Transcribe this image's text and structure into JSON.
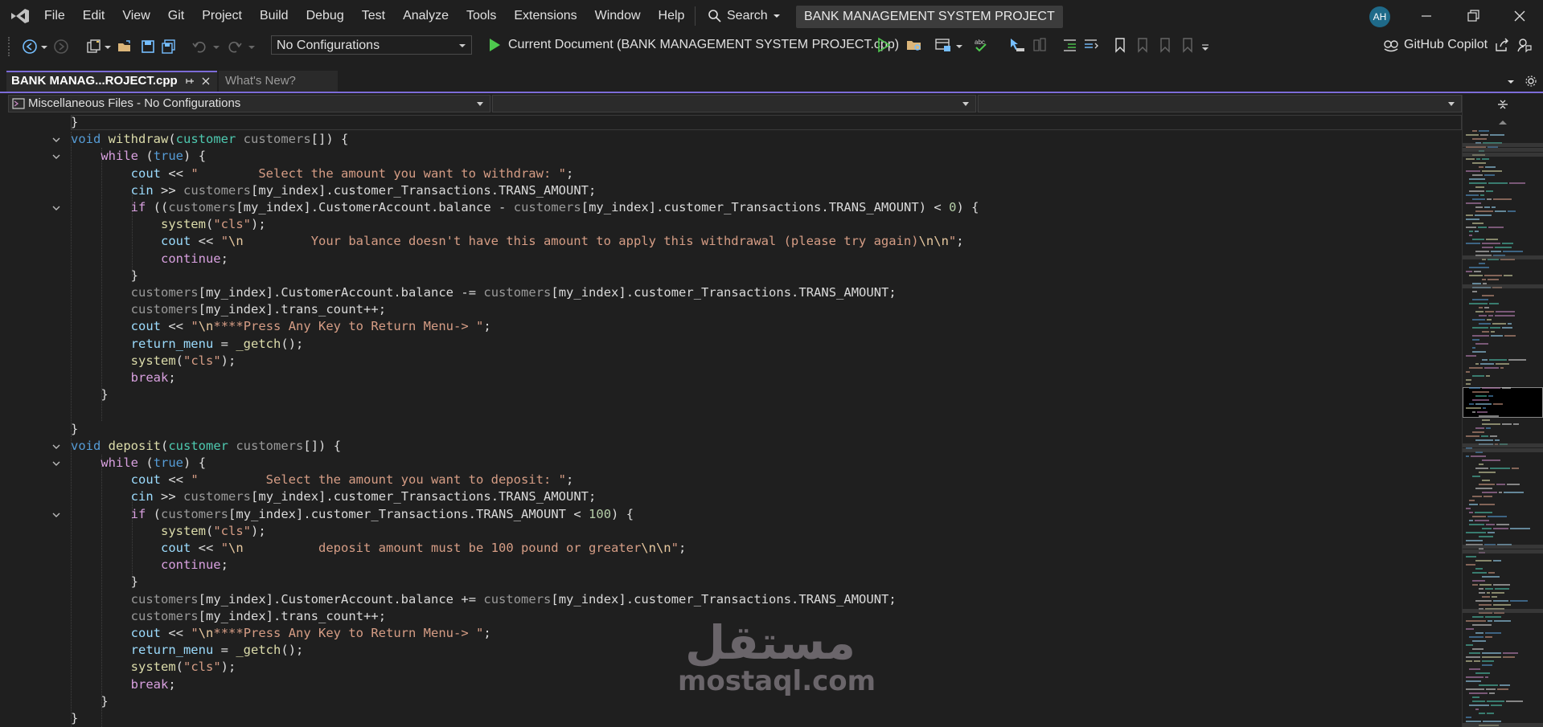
{
  "menu": [
    "File",
    "Edit",
    "View",
    "Git",
    "Project",
    "Build",
    "Debug",
    "Test",
    "Analyze",
    "Tools",
    "Extensions",
    "Window",
    "Help"
  ],
  "search_label": "Search",
  "window_title": "BANK MANAGEMENT SYSTEM PROJECT",
  "avatar_initials": "AH",
  "toolbar": {
    "configuration": "No Configurations",
    "run_target": "Current Document (BANK MANAGEMENT SYSTEM PROJECT.cpp)",
    "copilot": "GitHub Copilot"
  },
  "tabs": {
    "active": "BANK MANAG...ROJECT.cpp",
    "inactive": "What's New?"
  },
  "navbar": {
    "scope": "Miscellaneous Files - No Configurations"
  },
  "code_lines": [
    "}",
    "void withdraw(customer customers[]) {",
    "    while (true) {",
    "        cout << \"        Select the amount you want to withdraw: \";",
    "        cin >> customers[my_index].customer_Transactions.TRANS_AMOUNT;",
    "        if ((customers[my_index].CustomerAccount.balance - customers[my_index].customer_Transactions.TRANS_AMOUNT) < 0) {",
    "            system(\"cls\");",
    "            cout << \"\\n         Your balance doesn't have this amount to apply this withdrawal (please try again)\\n\\n\";",
    "            continue;",
    "        }",
    "        customers[my_index].CustomerAccount.balance -= customers[my_index].customer_Transactions.TRANS_AMOUNT;",
    "        customers[my_index].trans_count++;",
    "        cout << \"\\n****Press Any Key to Return Menu-> \";",
    "        return_menu = _getch();",
    "        system(\"cls\");",
    "        break;",
    "    }",
    "",
    "}",
    "void deposit(customer customers[]) {",
    "    while (true) {",
    "        cout << \"         Select the amount you want to deposit: \";",
    "        cin >> customers[my_index].customer_Transactions.TRANS_AMOUNT;",
    "        if (customers[my_index].customer_Transactions.TRANS_AMOUNT < 100) {",
    "            system(\"cls\");",
    "            cout << \"\\n          deposit amount must be 100 pound or greater\\n\\n\";",
    "            continue;",
    "        }",
    "        customers[my_index].CustomerAccount.balance += customers[my_index].customer_Transactions.TRANS_AMOUNT;",
    "        customers[my_index].trans_count++;",
    "        cout << \"\\n****Press Any Key to Return Menu-> \";",
    "        return_menu = _getch();",
    "        system(\"cls\");",
    "        break;",
    "    }",
    "}"
  ],
  "watermark": {
    "arabic": "مستقل",
    "latin": "mostaql.com"
  }
}
